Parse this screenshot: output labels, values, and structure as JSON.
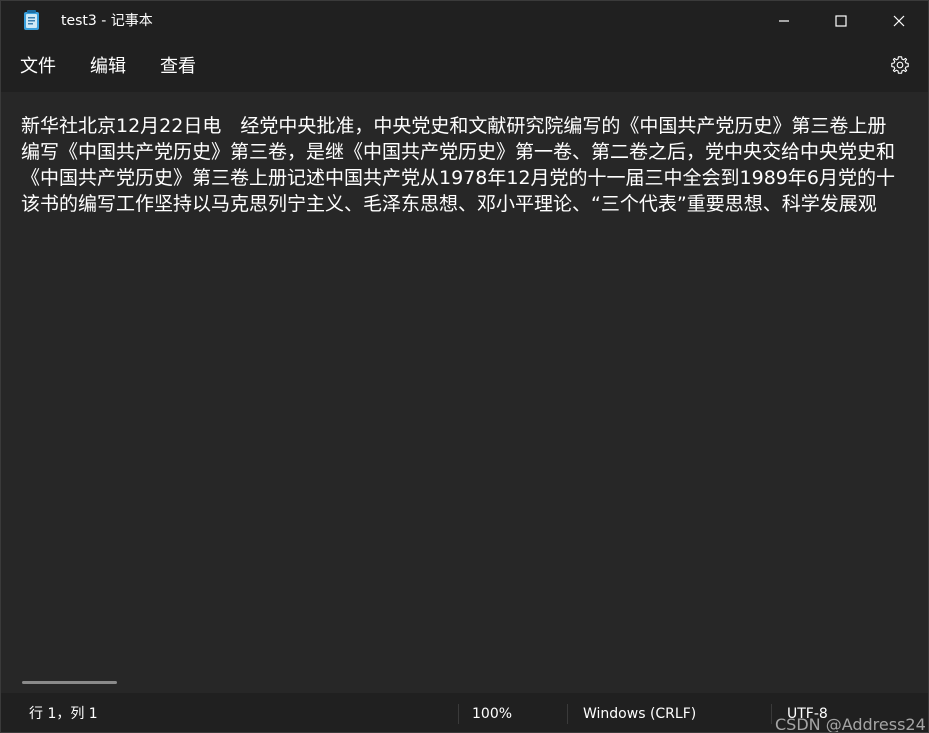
{
  "window": {
    "title": "test3 - 记事本",
    "icon": "notepad-icon"
  },
  "menu": {
    "items": [
      "文件",
      "编辑",
      "查看"
    ],
    "settings_icon": "gear-icon"
  },
  "editor": {
    "lines": [
      "新华社北京12月22日电　经党中央批准，中央党史和文献研究院编写的《中国共产党历史》第三卷上册",
      "编写《中国共产党历史》第三卷，是继《中国共产党历史》第一卷、第二卷之后，党中央交给中央党史和",
      "《中国共产党历史》第三卷上册记述中国共产党从1978年12月党的十一届三中全会到1989年6月党的十",
      "该书的编写工作坚持以马克思列宁主义、毛泽东思想、邓小平理论、“三个代表”重要思想、科学发展观"
    ]
  },
  "status": {
    "position": "行 1，列 1",
    "zoom": "100%",
    "line_ending": "Windows (CRLF)",
    "encoding": "UTF-8"
  },
  "watermark": "CSDN @Address24",
  "colors": {
    "background": "#272727",
    "chrome": "#202020",
    "text": "#ffffff"
  }
}
